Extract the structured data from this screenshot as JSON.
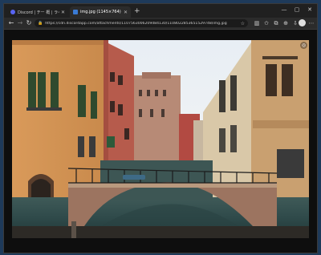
{
  "browser": {
    "tabs": [
      {
        "label": "Discord | チー 概 | ライダー・…",
        "favicon": "discord-icon",
        "active": false
      },
      {
        "label": "img.jpg (1145×764)",
        "favicon": "image-icon",
        "active": true
      }
    ],
    "new_tab_symbol": "+",
    "address": {
      "url": "https://cdn.discordapp.com/attachments/1107563006209484130/1108022853651529748/img.jpg"
    }
  },
  "colors": {
    "page_background": "#0e0e0e",
    "chrome": "#202020",
    "toolbar": "#2b2b2b",
    "discord_brand": "#5865f2"
  },
  "image": {
    "description_icons": [
      "image-lens-icon"
    ],
    "natural_size": "1145×764"
  }
}
